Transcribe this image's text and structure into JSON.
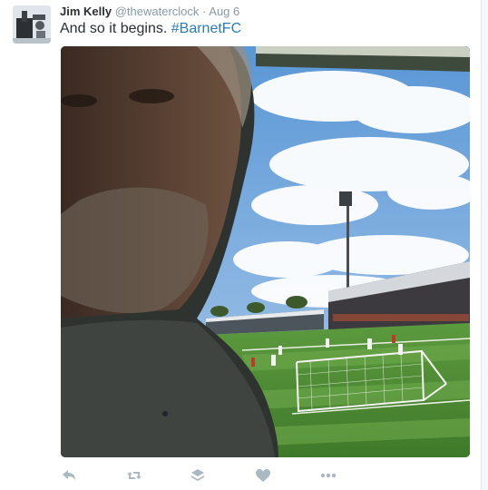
{
  "tweet": {
    "author_name": "Jim Kelly",
    "handle": "@thewaterclock",
    "separator": "·",
    "timestamp": "Aug 6",
    "text": "And so it begins.",
    "hashtag": "#BarnetFC"
  },
  "actions": {
    "reply_icon": "reply-icon",
    "retweet_icon": "retweet-icon",
    "buffer_icon": "stack-icon",
    "like_icon": "heart-icon",
    "more_icon": "more-icon"
  },
  "colors": {
    "name": "#292f33",
    "meta": "#8899a6",
    "hashtag": "#2b7bb9",
    "action_icons": "#aab8c2"
  }
}
